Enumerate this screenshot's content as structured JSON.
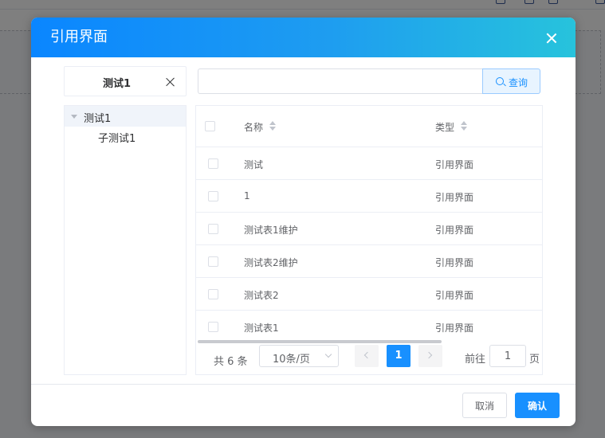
{
  "dialog": {
    "title": "引用界面",
    "close_icon": "close-icon"
  },
  "left": {
    "tab_label": "测试1",
    "tab_close_icon": "close-icon",
    "tree": {
      "root": {
        "label": "测试1",
        "expanded": true,
        "icon": "caret-down-icon"
      },
      "children": [
        {
          "label": "子测试1"
        }
      ]
    }
  },
  "search": {
    "value": "",
    "placeholder": "",
    "button_label": "查询",
    "button_icon": "search-icon"
  },
  "table": {
    "columns": [
      {
        "label": "名称",
        "sortable": true
      },
      {
        "label": "类型",
        "sortable": true
      }
    ],
    "rows": [
      {
        "name": "测试",
        "type": "引用界面"
      },
      {
        "name": "1",
        "type": "引用界面"
      },
      {
        "name": "测试表1维护",
        "type": "引用界面"
      },
      {
        "name": "测试表2维护",
        "type": "引用界面"
      },
      {
        "name": "测试表2",
        "type": "引用界面"
      },
      {
        "name": "测试表1",
        "type": "引用界面"
      }
    ]
  },
  "pagination": {
    "total_label": "共 6 条",
    "page_size_label": "10条/页",
    "current_page": "1",
    "goto_label": "前往",
    "goto_value": "1",
    "goto_unit": "页"
  },
  "footer": {
    "cancel_label": "取消",
    "confirm_label": "确认"
  },
  "colors": {
    "primary": "#1890ff",
    "header_gradient_start": "#0a86ff",
    "header_gradient_end": "#27c3dc",
    "overlay": "#000000"
  }
}
